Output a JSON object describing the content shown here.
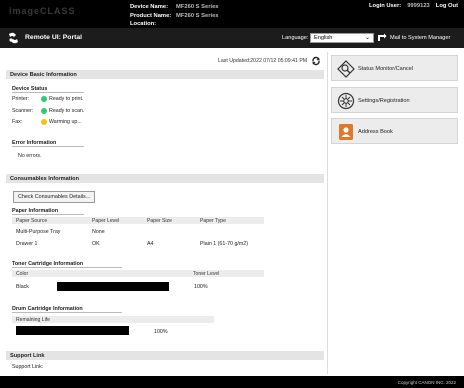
{
  "header": {
    "brand": "imageCLASS",
    "device_name_label": "Device Name:",
    "device_name_value": "MF260 S Series",
    "product_name_label": "Product Name:",
    "product_name_value": "MF260 S Series",
    "location_label": "Location:",
    "login_user_label": "Login User:",
    "login_user_value": "9999123",
    "logout_label": "Log Out"
  },
  "titlebar": {
    "title": "Remote UI: Portal",
    "language_label": "Language:",
    "language_value": "English",
    "mail_link": "Mail to System Manager"
  },
  "main": {
    "last_updated": "Last Updated:2022 07/12 05:09:41 PM",
    "device_basic_info": {
      "title": "Device Basic Information",
      "status_title": "Device Status",
      "rows": [
        {
          "label": "Printer:",
          "status": "Ready to print.",
          "color": "#2ecc71"
        },
        {
          "label": "Scanner:",
          "status": "Ready to scan.",
          "color": "#2ecc71"
        },
        {
          "label": "Fax:",
          "status": "Warming up...",
          "color": "#f1c40f"
        }
      ],
      "error_title": "Error Information",
      "error_text": "No errors."
    },
    "consumables": {
      "title": "Consumables Information",
      "check_button": "Check Consumables Details...",
      "paper_title": "Paper Information",
      "paper_headers": [
        "Paper Source",
        "Paper Level",
        "Paper Size",
        "Paper Type"
      ],
      "paper_rows": [
        [
          "Multi-Purpose Tray",
          "None",
          "",
          ""
        ],
        [
          "Drawer 1",
          "OK",
          "A4",
          "Plain 1 (61-70 g/m2)"
        ]
      ],
      "toner_title": "Toner Cartridge Information",
      "toner_headers": [
        "Color",
        "Toner Level"
      ],
      "toner_rows": [
        {
          "color": "Black",
          "level": "100%",
          "level_value": 100
        }
      ],
      "drum_title": "Drum Cartridge Information",
      "drum_headers": [
        "Remaining Life"
      ],
      "drum_rows": [
        {
          "level": "100%",
          "level_value": 100
        }
      ]
    },
    "support": {
      "title": "Support Link",
      "label": "Support Link:"
    }
  },
  "sidebar": {
    "items": [
      {
        "label": "Status Monitor/Cancel",
        "icon": "status-monitor-icon"
      },
      {
        "label": "Settings/Registration",
        "icon": "settings-icon"
      },
      {
        "label": "Address Book",
        "icon": "address-book-icon"
      }
    ]
  },
  "footer": {
    "copyright": "Copyright CANON INC. 2022"
  }
}
